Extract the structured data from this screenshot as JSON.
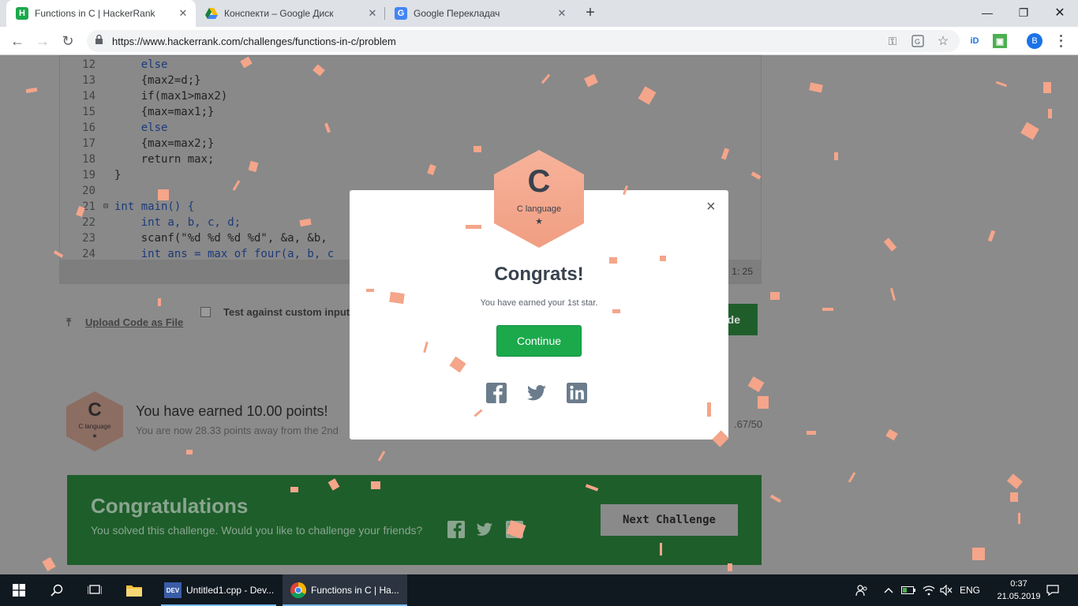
{
  "browser": {
    "tabs": [
      {
        "title": "Functions in C | HackerRank",
        "favicon": "hackerrank-icon",
        "active": true
      },
      {
        "title": "Конспекти – Google Диск",
        "favicon": "google-drive-icon",
        "active": false
      },
      {
        "title": "Google Перекладач",
        "favicon": "google-translate-icon",
        "active": false
      }
    ],
    "url": "https://www.hackerrank.com/challenges/functions-in-c/problem",
    "profile_initial": "B"
  },
  "editor": {
    "lines": [
      {
        "num": "12",
        "code": "    else"
      },
      {
        "num": "13",
        "code": "    {max2=d;}"
      },
      {
        "num": "14",
        "code": "    if(max1>max2)"
      },
      {
        "num": "15",
        "code": "    {max=max1;}"
      },
      {
        "num": "16",
        "code": "    else"
      },
      {
        "num": "17",
        "code": "    {max=max2;}"
      },
      {
        "num": "18",
        "code": "    return max;"
      },
      {
        "num": "19",
        "code": "}"
      },
      {
        "num": "20",
        "code": ""
      },
      {
        "num": "21",
        "code": "int main() {"
      },
      {
        "num": "22",
        "code": "    int a, b, c, d;"
      },
      {
        "num": "23",
        "code": "    scanf(\"%d %d %d %d\", &a, &b,"
      },
      {
        "num": "24",
        "code": "    int ans = max_of_four(a, b, c"
      }
    ],
    "status": "1: 25"
  },
  "controls": {
    "upload_label": "Upload Code as File",
    "custom_input_label": "Test against custom input",
    "submit_label": "de"
  },
  "earned": {
    "badge_letter": "C",
    "badge_lang": "C language",
    "badge_star": "★",
    "title": "You have earned 10.00 points!",
    "subtitle": "You are now 28.33 points away from the 2nd",
    "points_progress": ".67/50"
  },
  "congrats_bar": {
    "title": "Congratulations",
    "subtitle": "You solved this challenge. Would you like to challenge your friends?",
    "next_label": "Next Challenge"
  },
  "modal": {
    "badge_letter": "C",
    "badge_lang": "C language",
    "badge_star": "★",
    "title": "Congrats!",
    "message": "You have earned your 1st star.",
    "continue_label": "Continue",
    "close_symbol": "×"
  },
  "taskbar": {
    "apps": [
      {
        "title": "Untitled1.cpp - Dev...",
        "icon": "dev-cpp-icon",
        "active": false
      },
      {
        "title": "Functions in C | Ha...",
        "icon": "chrome-icon",
        "active": true
      }
    ],
    "language": "ENG",
    "time": "0:37",
    "date": "21.05.2019"
  },
  "colors": {
    "hackerrank_green": "#1ba94c",
    "badge_fill": "#f6b096",
    "confetti": "#f4a58a"
  }
}
